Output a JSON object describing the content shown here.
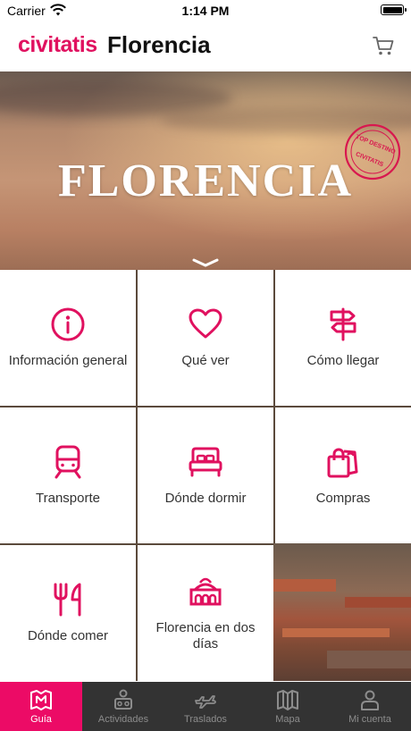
{
  "status_bar": {
    "carrier": "Carrier",
    "time": "1:14 PM"
  },
  "header": {
    "brand": "civitatis",
    "city": "Florencia"
  },
  "hero": {
    "title": "FLORENCIA",
    "stamp_text": "TOP DESTINO · CIVITATIS"
  },
  "menu": [
    {
      "label": "Información general",
      "icon": "info-icon"
    },
    {
      "label": "Qué ver",
      "icon": "heart-icon"
    },
    {
      "label": "Cómo llegar",
      "icon": "signpost-icon"
    },
    {
      "label": "Transporte",
      "icon": "train-icon"
    },
    {
      "label": "Dónde dormir",
      "icon": "bed-icon"
    },
    {
      "label": "Compras",
      "icon": "shopping-bags-icon"
    },
    {
      "label": "Dónde comer",
      "icon": "fork-knife-icon"
    },
    {
      "label": "Florencia en dos días",
      "icon": "monument-icon"
    }
  ],
  "tabs": [
    {
      "label": "Guía",
      "icon": "map-guide-icon",
      "active": true
    },
    {
      "label": "Actividades",
      "icon": "activities-icon",
      "active": false
    },
    {
      "label": "Traslados",
      "icon": "plane-icon",
      "active": false
    },
    {
      "label": "Mapa",
      "icon": "map-icon",
      "active": false
    },
    {
      "label": "Mi cuenta",
      "icon": "user-icon",
      "active": false
    }
  ],
  "colors": {
    "brand": "#e0115f",
    "tab_active": "#ec0b66",
    "tab_bar": "#333333"
  }
}
